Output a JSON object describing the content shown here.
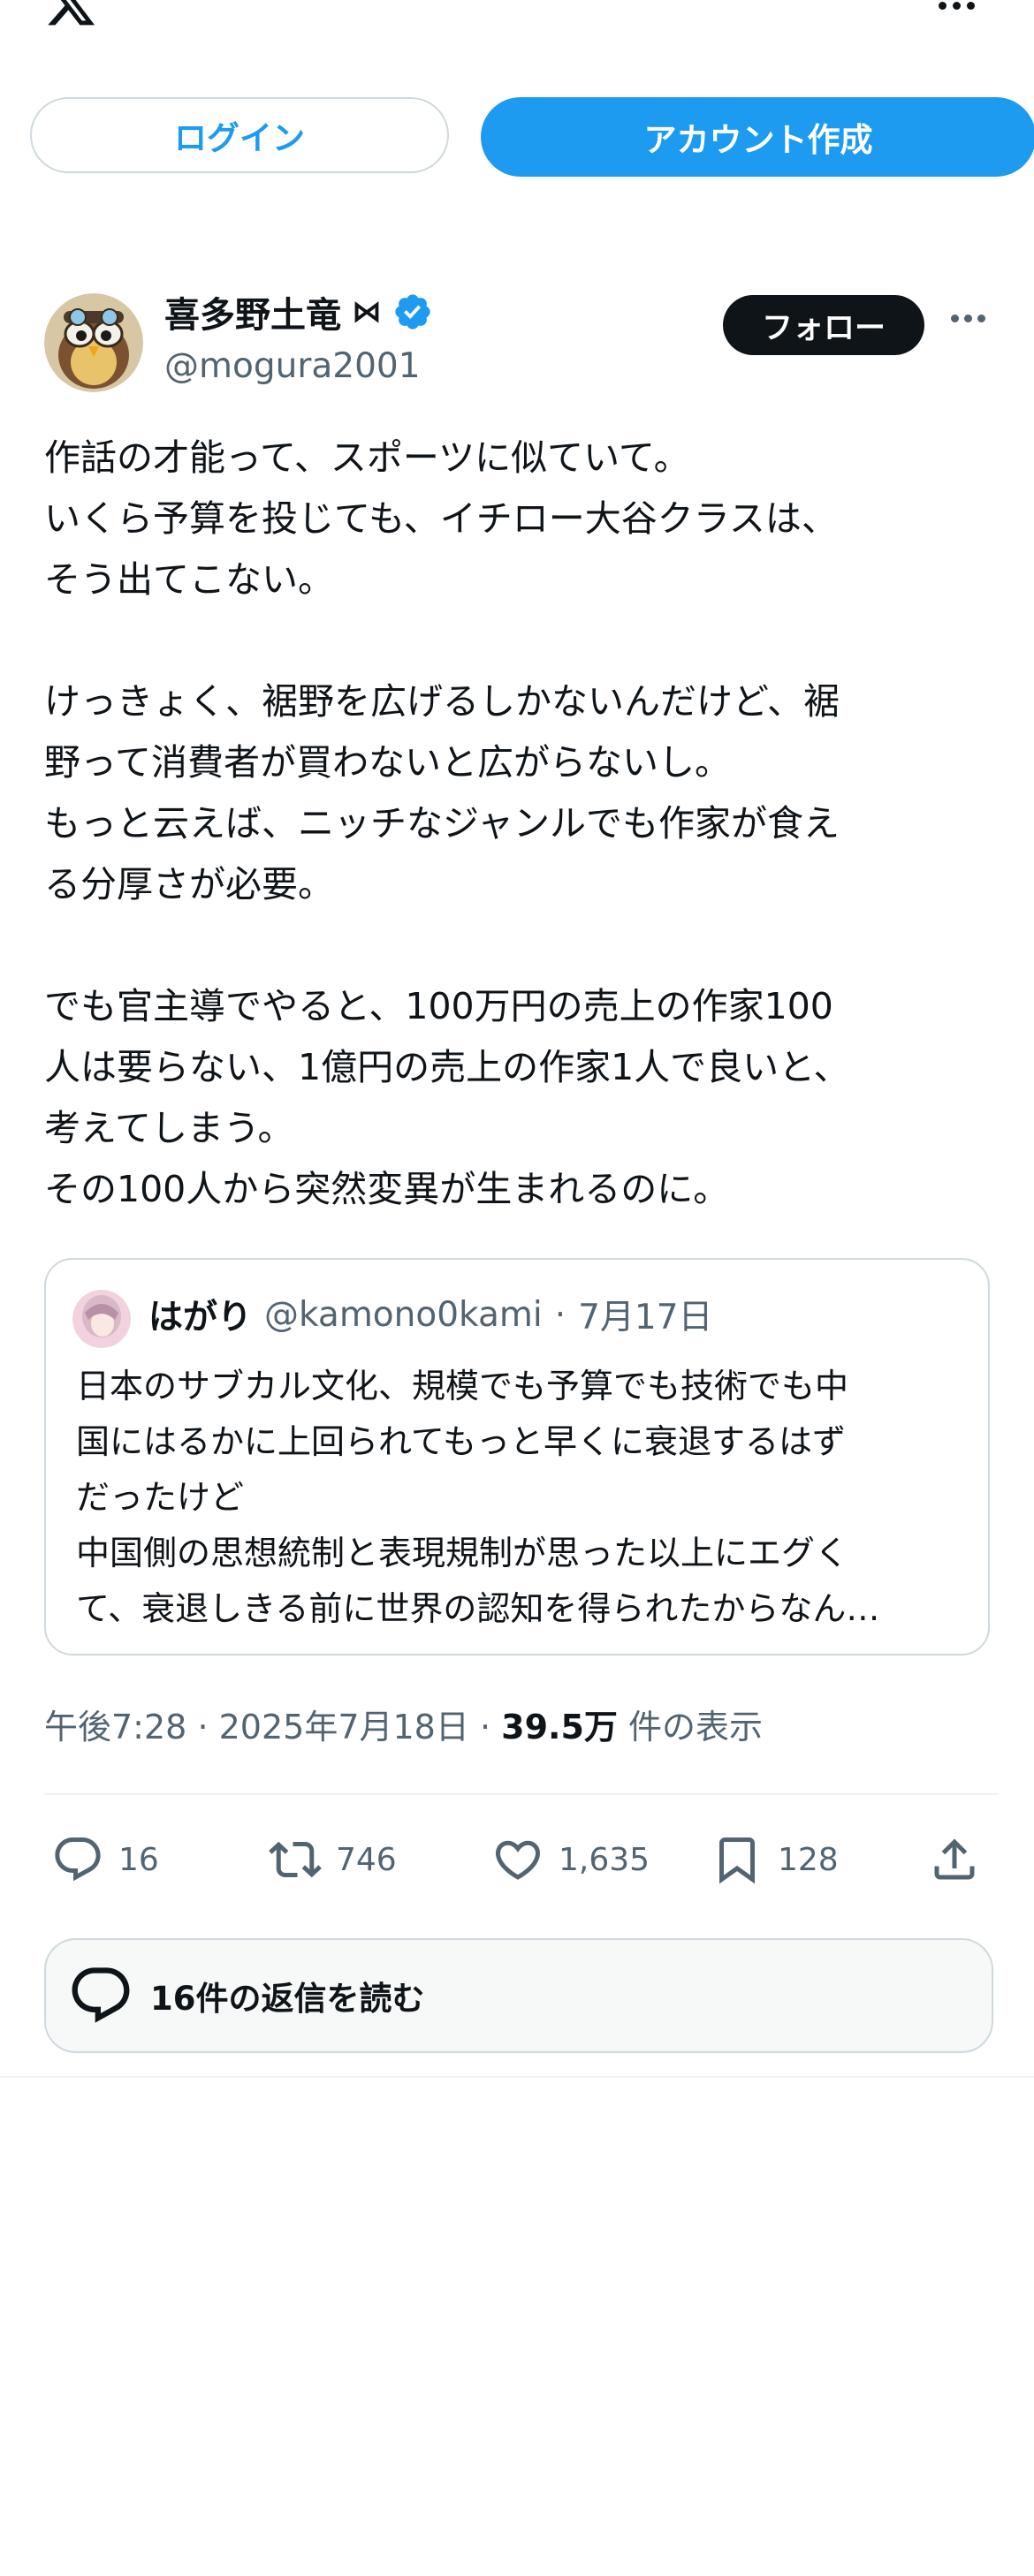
{
  "header": {
    "logo_icon": "x-logo-icon",
    "more_icon": "more-horizontal-icon"
  },
  "auth": {
    "login_label": "ログイン",
    "signup_label": "アカウント作成"
  },
  "post": {
    "author_name": "喜多野土竜",
    "name_symbol": "⋈",
    "handle": "@mogura2001",
    "follow_label": "フォロー",
    "text": "作話の才能って、スポーツに似ていて。\nいくら予算を投じても、イチロー大谷クラスは、\nそう出てこない。\n\nけっきょく、裾野を広げるしかないんだけど、裾\n野って消費者が買わないと広がらないし。\nもっと云えば、ニッチなジャンルでも作家が食え\nる分厚さが必要。\n\nでも官主導でやると、100万円の売上の作家100\n人は要らない、1億円の売上の作家1人で良いと、\n考えてしまう。\nその100人から突然変異が生まれるのに。",
    "quote": {
      "author_name": "はがり",
      "handle": "@kamono0kami",
      "separator": "·",
      "date": "7月17日",
      "text": "日本のサブカル文化、規模でも予算でも技術でも中\n国にはるかに上回られてもっと早くに衰退するはず\nだったけど\n中国側の思想統制と表現規制が思った以上にエグく\nて、衰退しきる前に世界の認知を得られたからなん…"
    },
    "time": "午後7:28",
    "dot": "·",
    "date": "2025年7月18日",
    "views_count": "39.5万",
    "views_label": "件の表示",
    "stats": {
      "replies": "16",
      "reposts": "746",
      "likes": "1,635",
      "bookmarks": "128"
    },
    "read_replies_label": "16件の返信を読む"
  },
  "colors": {
    "accent": "#1d9bf0",
    "text": "#0f1419",
    "muted": "#536471",
    "border": "#cfd9de"
  }
}
